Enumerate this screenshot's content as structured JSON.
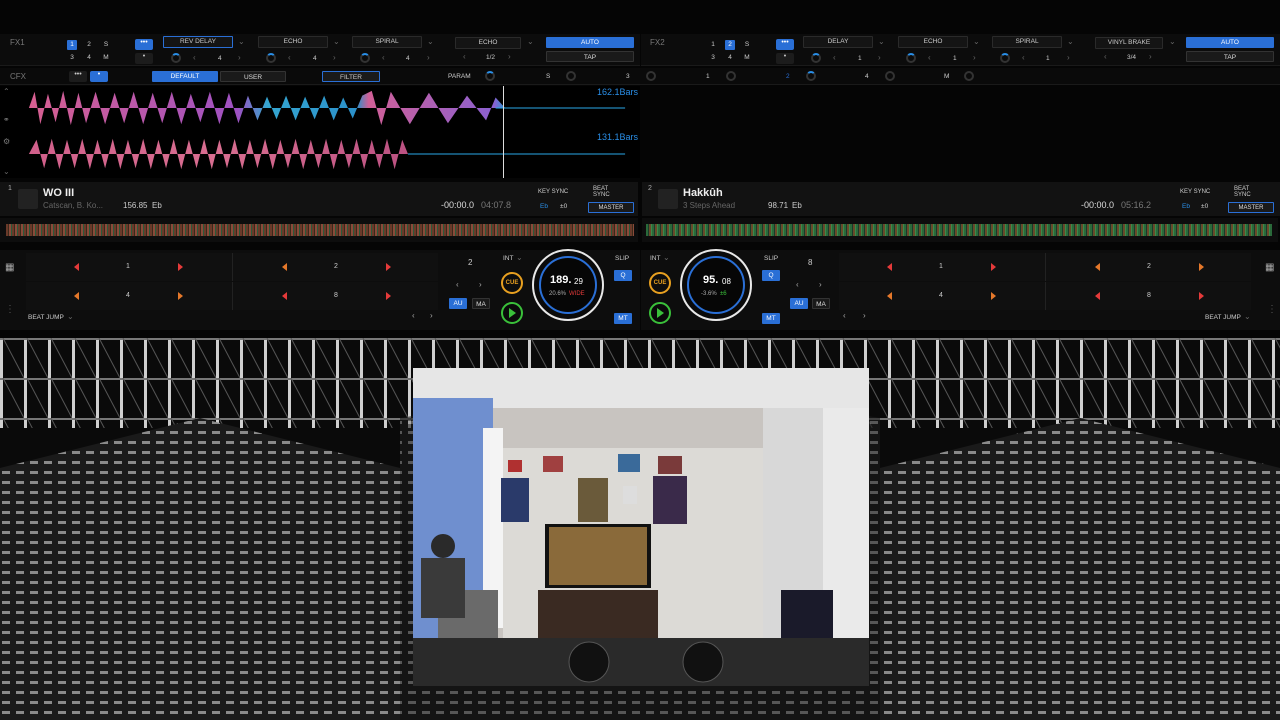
{
  "fx1": {
    "label": "FX1",
    "units": [
      "1",
      "2",
      "S",
      "3",
      "4",
      "M"
    ],
    "slot1": "REV DELAY",
    "slot2": "ECHO",
    "slot3": "SPIRAL",
    "val1": "4",
    "val2": "4",
    "val3": "4",
    "beat_select": "ECHO",
    "beat_value": "1/2",
    "auto": "AUTO",
    "tap": "TAP"
  },
  "fx2": {
    "label": "FX2",
    "units": [
      "1",
      "2",
      "S",
      "3",
      "4",
      "M"
    ],
    "slot1": "DELAY",
    "slot2": "ECHO",
    "slot3": "SPIRAL",
    "val1": "1",
    "val2": "1",
    "val3": "1",
    "beat_select": "VINYL BRAKE",
    "beat_value": "3/4",
    "auto": "AUTO",
    "tap": "TAP"
  },
  "cfx": {
    "label": "CFX",
    "tab_default": "DEFAULT",
    "tab_user": "USER",
    "filter": "FILTER",
    "param": "PARAM",
    "s": "S",
    "n3": "3",
    "n1": "1",
    "n2": "2",
    "n4": "4",
    "m": "M"
  },
  "waveform": {
    "bars1": "162.1Bars",
    "bars2": "131.1Bars"
  },
  "deck1": {
    "number": "1",
    "title": "WO III",
    "artist": "Catscan, B. Ko...",
    "bpm": "156.85",
    "key": "Eb",
    "time_remaining": "-00:00.0",
    "time_total": "04:07.8",
    "key_sync": "KEY SYNC",
    "beat_sync": "BEAT SYNC",
    "key_display": "Eb",
    "key_offset": "±0",
    "master": "MASTER",
    "pads_top": [
      "1",
      "2"
    ],
    "pads_bottom": [
      "4",
      "8"
    ],
    "beat_jump": "BEAT JUMP",
    "loop_size": "2",
    "int": "INT",
    "cue": "CUE",
    "au": "AU",
    "ma": "MA",
    "slip": "SLIP",
    "q": "Q",
    "mt": "MT",
    "jog_bpm": "189.",
    "jog_bpm_dec": "29",
    "jog_pitch": "20.6%",
    "jog_range": "WIDE"
  },
  "deck2": {
    "number": "2",
    "title": "Hakkûh",
    "artist": "3 Steps Ahead",
    "bpm": "98.71",
    "key": "Eb",
    "time_remaining": "-00:00.0",
    "time_total": "05:16.2",
    "key_sync": "KEY SYNC",
    "beat_sync": "BEAT SYNC",
    "key_display": "Eb",
    "key_offset": "±0",
    "master": "MASTER",
    "pads_top": [
      "1",
      "2"
    ],
    "pads_bottom": [
      "4",
      "8"
    ],
    "beat_jump": "BEAT JUMP",
    "loop_size": "8",
    "int": "INT",
    "cue": "CUE",
    "au": "AU",
    "ma": "MA",
    "slip": "SLIP",
    "q": "Q",
    "mt": "MT",
    "jog_bpm": "95.",
    "jog_bpm_dec": "08",
    "jog_pitch": "-3.6%",
    "jog_range": "±6"
  },
  "colors": {
    "accent": "#2a6fd6",
    "cue": "#e8a020",
    "play": "#3ac03a",
    "pad_arrow": "#e53a3a"
  }
}
